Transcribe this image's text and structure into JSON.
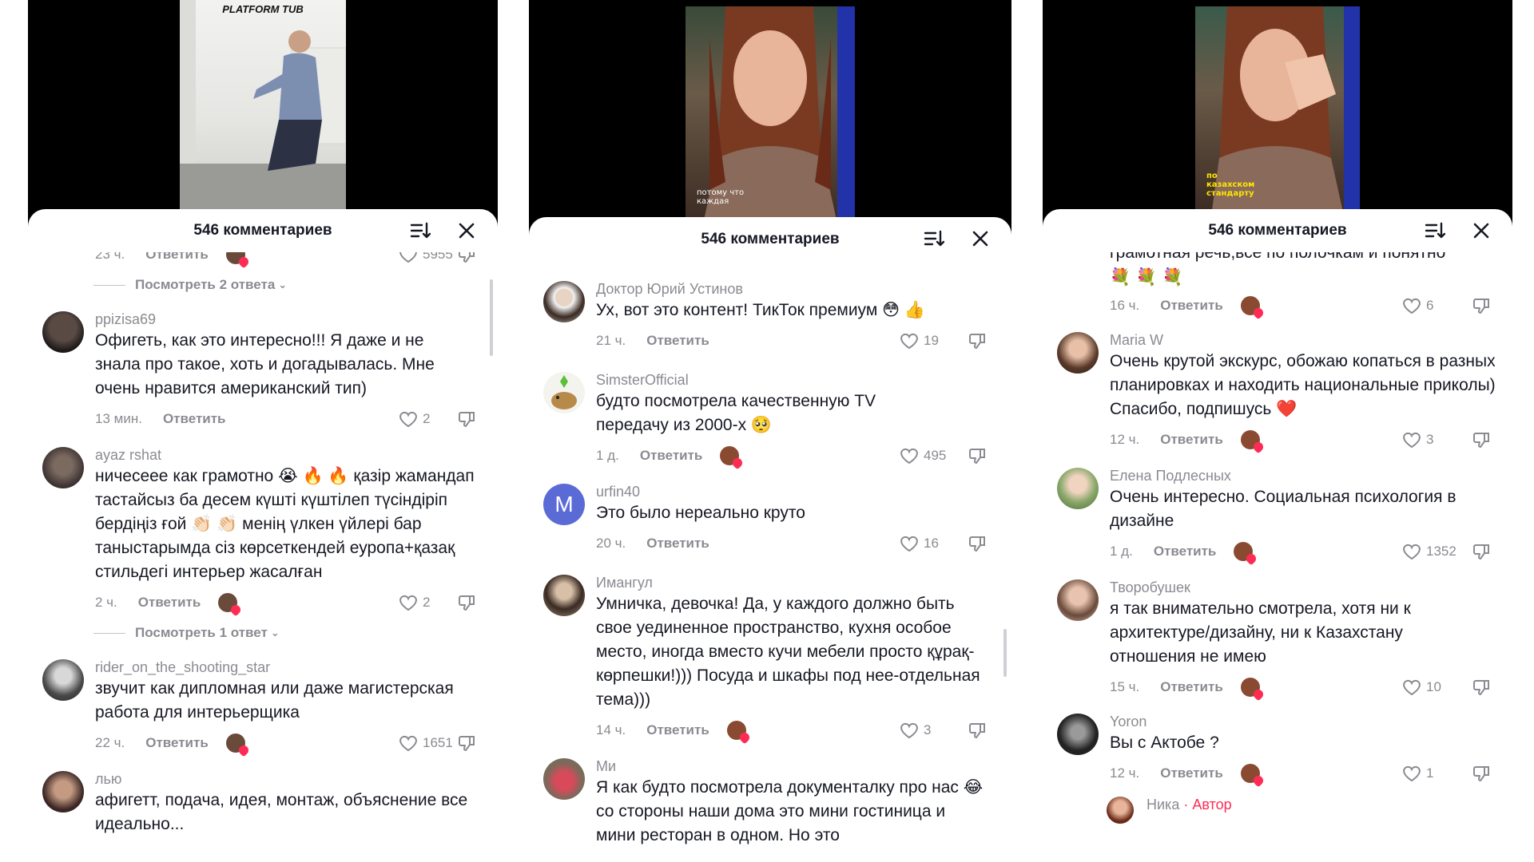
{
  "sheet_title": "546 комментариев",
  "reply_label": "Ответить",
  "panel1": {
    "video_caption": "PLATFORM TUB",
    "top_partial": {
      "time": "23 ч.",
      "likes": "5955"
    },
    "view_replies_1": "Посмотреть 2 ответа",
    "view_replies_2": "Посмотреть 1 ответ",
    "comments": [
      {
        "user": "ppizisa69",
        "text": "Офигеть, как это интересно!!! Я даже и не знала про такое, хоть и догадывалась. Мне очень нравится американский тип)",
        "time": "13 мин.",
        "likes": "2"
      },
      {
        "user": "ayaz  rshat",
        "text": "ничесеее как грамотно 😭 🔥 🔥 қазір жамандап тастайсыз ба десем күшті күштілеп түсіндіріп бердіңіз ғой 👏🏻 👏🏻 менің үлкен үйлері бар таныстарымда сіз көрсеткендей еуропа+қазақ стильдегі интерьер жасалған",
        "time": "2 ч.",
        "likes": "2"
      },
      {
        "user": "rider_on_the_shooting_star",
        "text": "звучит как дипломная или даже магистерская работа для интерьерщика",
        "time": "22 ч.",
        "likes": "1651"
      },
      {
        "user": "лью",
        "text": "афигетт, подача, идея, монтаж, объяснение все идеально..."
      }
    ]
  },
  "panel2": {
    "video_caption": "потому что каждая",
    "comments": [
      {
        "user": "Доктор Юрий Устинов",
        "text": "Ух, вот это контент! ТикТок премиум 😳 👍",
        "time": "21 ч.",
        "likes": "19"
      },
      {
        "user": "SimsterOfficial",
        "text": "будто посмотрела качественную TV передачу из 2000-х 🥺",
        "time": "1 д.",
        "likes": "495"
      },
      {
        "user": "urfin40",
        "avatar_letter": "M",
        "text": "Это было нереально круто",
        "time": "20 ч.",
        "likes": "16"
      },
      {
        "user": "Имангул",
        "text": "Умничка, девочка! Да, у каждого должно быть свое уединенное пространство, кухня особое место, иногда вместо кучи мебели просто құрақ-көрпешки!))) Посуда и шкафы под нее-отдельная тема)))",
        "time": "14 ч.",
        "likes": "3"
      },
      {
        "user": "Ми",
        "text": "Я как будто посмотрела документалку про нас 😂 со стороны наши дома это мини гостиница и мини ресторан в одном. Но это"
      }
    ]
  },
  "panel3": {
    "video_caption": "по казахском стандарту",
    "top_partial": {
      "text": "грамотная речь,все по полочкам и понятно",
      "emojis": "💐 💐 💐",
      "time": "16 ч.",
      "likes": "6"
    },
    "comments": [
      {
        "user": "Maria W",
        "text": "Очень крутой экскурс, обожаю копаться в разных планировках и находить национальные приколы) Спасибо, подпишусь ❤️",
        "time": "12 ч.",
        "likes": "3"
      },
      {
        "user": "Елена Подлесных",
        "text": "Очень интересно. Социальная психология в дизайне",
        "time": "1 д.",
        "likes": "1352"
      },
      {
        "user": "Творобушек",
        "text": "я так внимательно смотрела, хотя ни к архитектуре/дизайну, ни к Казахстану отношения не имею",
        "time": "15 ч.",
        "likes": "10"
      },
      {
        "user": "Yoron",
        "text": "Вы с Актобе ?",
        "time": "12 ч.",
        "likes": "1"
      },
      {
        "user": "Ника",
        "author_badge": "· Автор"
      }
    ]
  },
  "colors": {
    "accent": "#fe2c55",
    "muted": "#8a8b91",
    "text": "#161823",
    "avatar_m": "#5b6bd6"
  }
}
